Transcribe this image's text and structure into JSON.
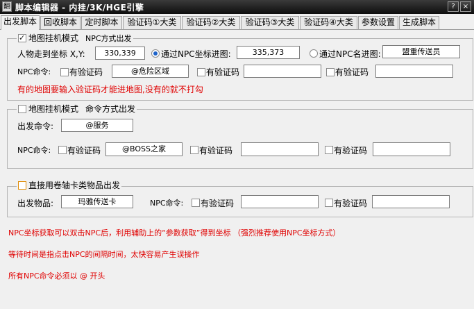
{
  "window": {
    "title": "脚本编辑器 - 内挂/3K/HGE引擎",
    "app_icon": "app-icon",
    "controls": {
      "help": "?",
      "close": "×"
    }
  },
  "tabs": [
    {
      "label": "出发脚本",
      "active": true
    },
    {
      "label": "回收脚本"
    },
    {
      "label": "定时脚本"
    },
    {
      "label": "验证码①大类"
    },
    {
      "label": "验证码②大类"
    },
    {
      "label": "验证码③大类"
    },
    {
      "label": "验证码④大类"
    },
    {
      "label": "参数设置"
    },
    {
      "label": "生成脚本"
    }
  ],
  "group1": {
    "title": "地图挂机模式",
    "subtitle": "NPC方式出发",
    "checked": true,
    "coords_label": "人物走到坐标 X,Y:",
    "coords_value": "330,339",
    "radio_coord_label": "通过NPC坐标进图:",
    "radio_coord_checked": true,
    "npc_coord_value": "335,373",
    "radio_name_label": "通过NPC名进图:",
    "npc_name_value": "盟重传送员",
    "npc_cmd_label": "NPC命令:",
    "verify_label": "有验证码",
    "npc_cmd1_value": "@危险区域",
    "npc_cmd2_value": "",
    "npc_cmd3_value": "",
    "note": "有的地图要输入验证码才能进地图,没有的就不打勾"
  },
  "group2": {
    "title": "地图挂机模式",
    "subtitle": "命令方式出发",
    "checked": false,
    "depart_cmd_label": "出发命令:",
    "depart_cmd_value": "@服务",
    "npc_cmd_label": "NPC命令:",
    "verify_label": "有验证码",
    "npc_cmd1_value": "@BOSS之家",
    "npc_cmd2_value": "",
    "npc_cmd3_value": ""
  },
  "group3": {
    "title": "直接用卷轴卡类物品出发",
    "checked": false,
    "item_label": "出发物品:",
    "item_value": "玛雅传送卡",
    "npc_cmd_label": "NPC命令:",
    "verify_label": "有验证码",
    "npc_cmd1_value": "",
    "npc_cmd2_value": "",
    "npc_cmd3_value": ""
  },
  "notes": [
    "NPC坐标获取可以双击NPC后，利用辅助上的“参数获取”得到坐标 （强烈推荐使用NPC坐标方式）",
    "等待时间是指点击NPC的间隔时间，太快容易产生误操作",
    "所有NPC命令必须以 @ 开头"
  ],
  "colors": {
    "note_red": "#e00000",
    "titlebar": "#1a1a1a",
    "radio_dot": "#1e63c9"
  }
}
